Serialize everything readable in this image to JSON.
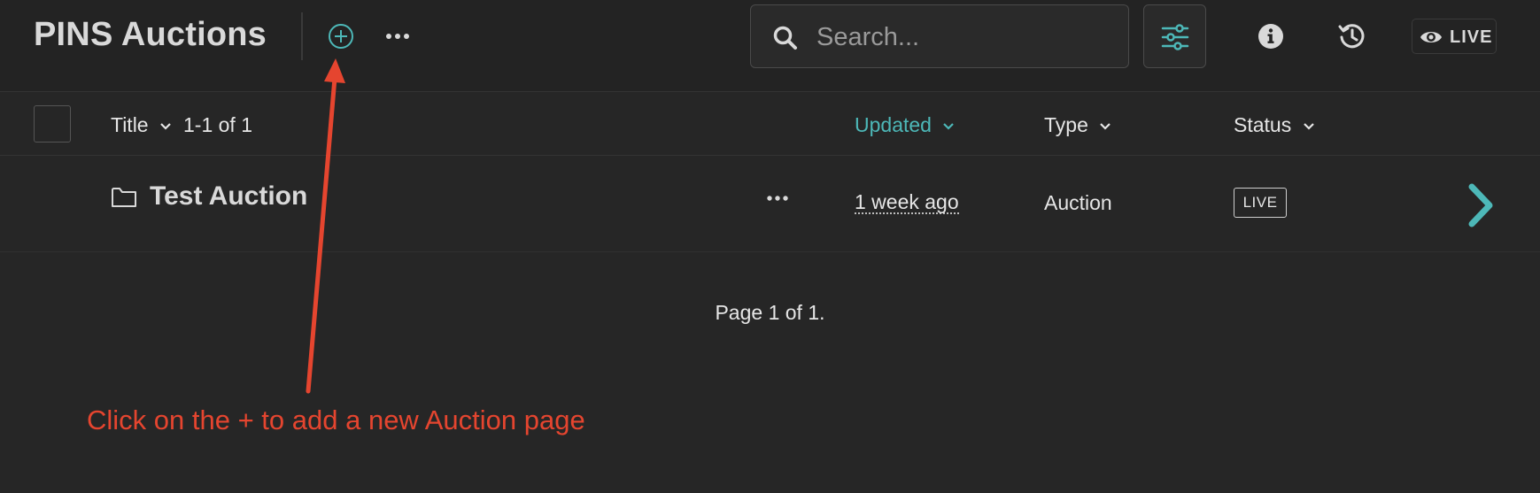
{
  "app": {
    "title": "PINS Auctions"
  },
  "toolbar": {
    "search_placeholder": "Search...",
    "live_label": "LIVE"
  },
  "table": {
    "columns": {
      "title": "Title",
      "count": "1-1 of 1",
      "updated": "Updated",
      "type": "Type",
      "status": "Status"
    },
    "rows": [
      {
        "title": "Test Auction",
        "updated": "1 week ago",
        "type": "Auction",
        "status": "LIVE"
      }
    ]
  },
  "pagination": {
    "text": "Page 1 of 1."
  },
  "annotation": {
    "text": "Click on the + to add a new Auction page"
  },
  "colors": {
    "accent": "#4db8b8",
    "annotation": "#e5452f",
    "background": "#262626"
  }
}
